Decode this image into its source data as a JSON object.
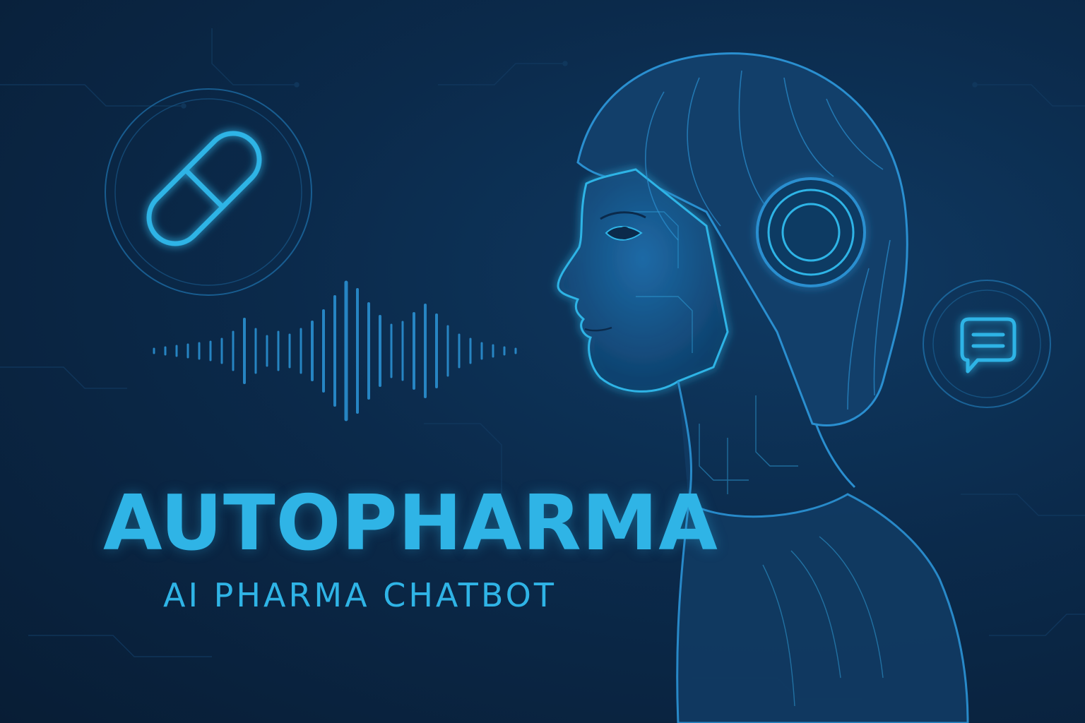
{
  "brand": {
    "title": "AUTOPHARMA",
    "subtitle": "AI PHARMA CHATBOT"
  },
  "colors": {
    "background": "#0a2440",
    "accent": "#2fb4e6",
    "figure_fill": "#15507f",
    "line": "#2a8fd0"
  },
  "icons": {
    "pill": "pill-icon",
    "chat": "chat-bubble-icon",
    "sound_wave": "sound-wave-icon",
    "headset": "headset-ear-icon",
    "avatar": "ai-woman-profile"
  }
}
